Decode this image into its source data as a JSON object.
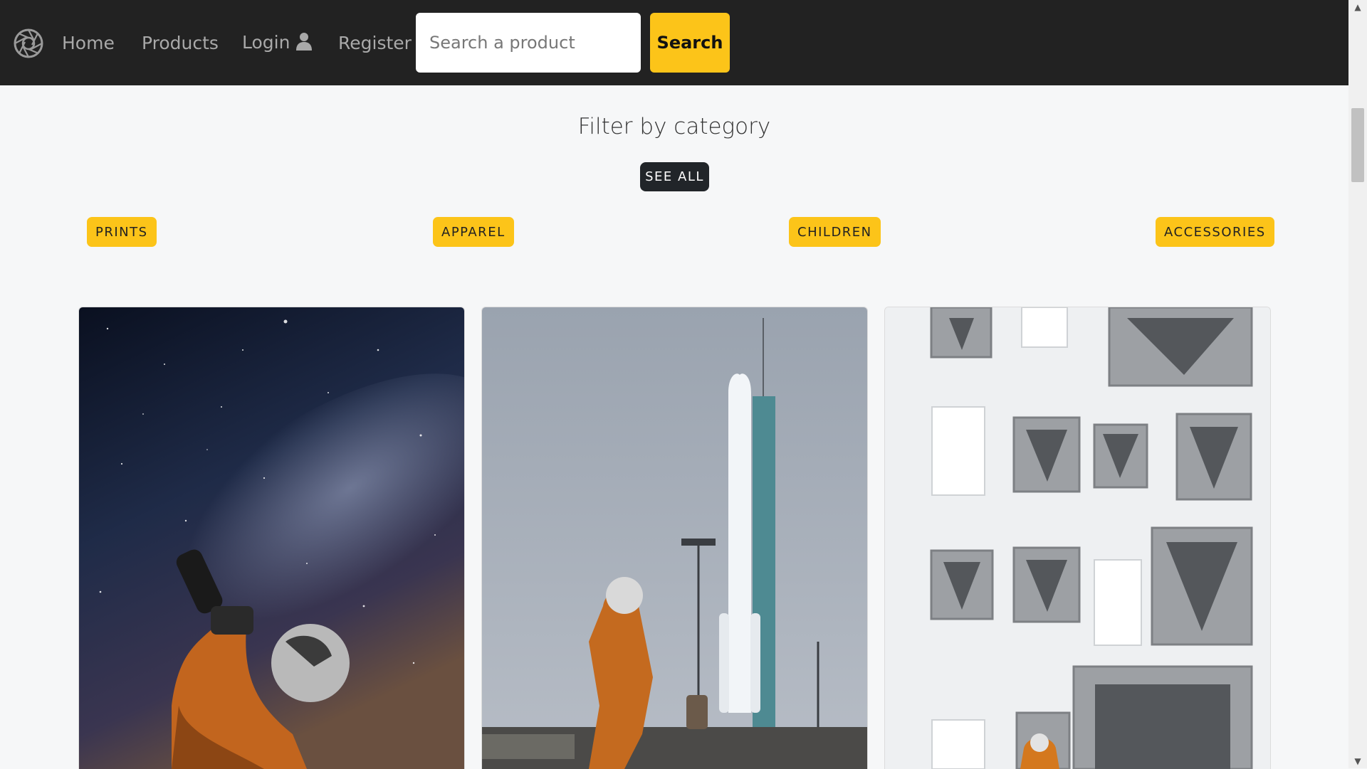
{
  "nav": {
    "links": [
      "Home",
      "Products",
      "Login",
      "Register"
    ],
    "logo_icon": "aperture-icon",
    "login_icon": "user-icon"
  },
  "search": {
    "placeholder": "Search a product",
    "button_label": "Search"
  },
  "filter": {
    "title": "Filter by category",
    "see_all_label": "SEE ALL",
    "categories": [
      "PRINTS",
      "APPAREL",
      "CHILDREN",
      "ACCESSORIES"
    ]
  },
  "products": [
    {
      "image": "astronaut photographing milky way"
    },
    {
      "image": "astronaut walking to rocket launch pad"
    },
    {
      "image": "astronaut in test chamber"
    }
  ],
  "colors": {
    "navbar": "#222222",
    "accent": "#fcc419",
    "dark_button": "#212529",
    "page_bg": "#f6f7f8"
  }
}
